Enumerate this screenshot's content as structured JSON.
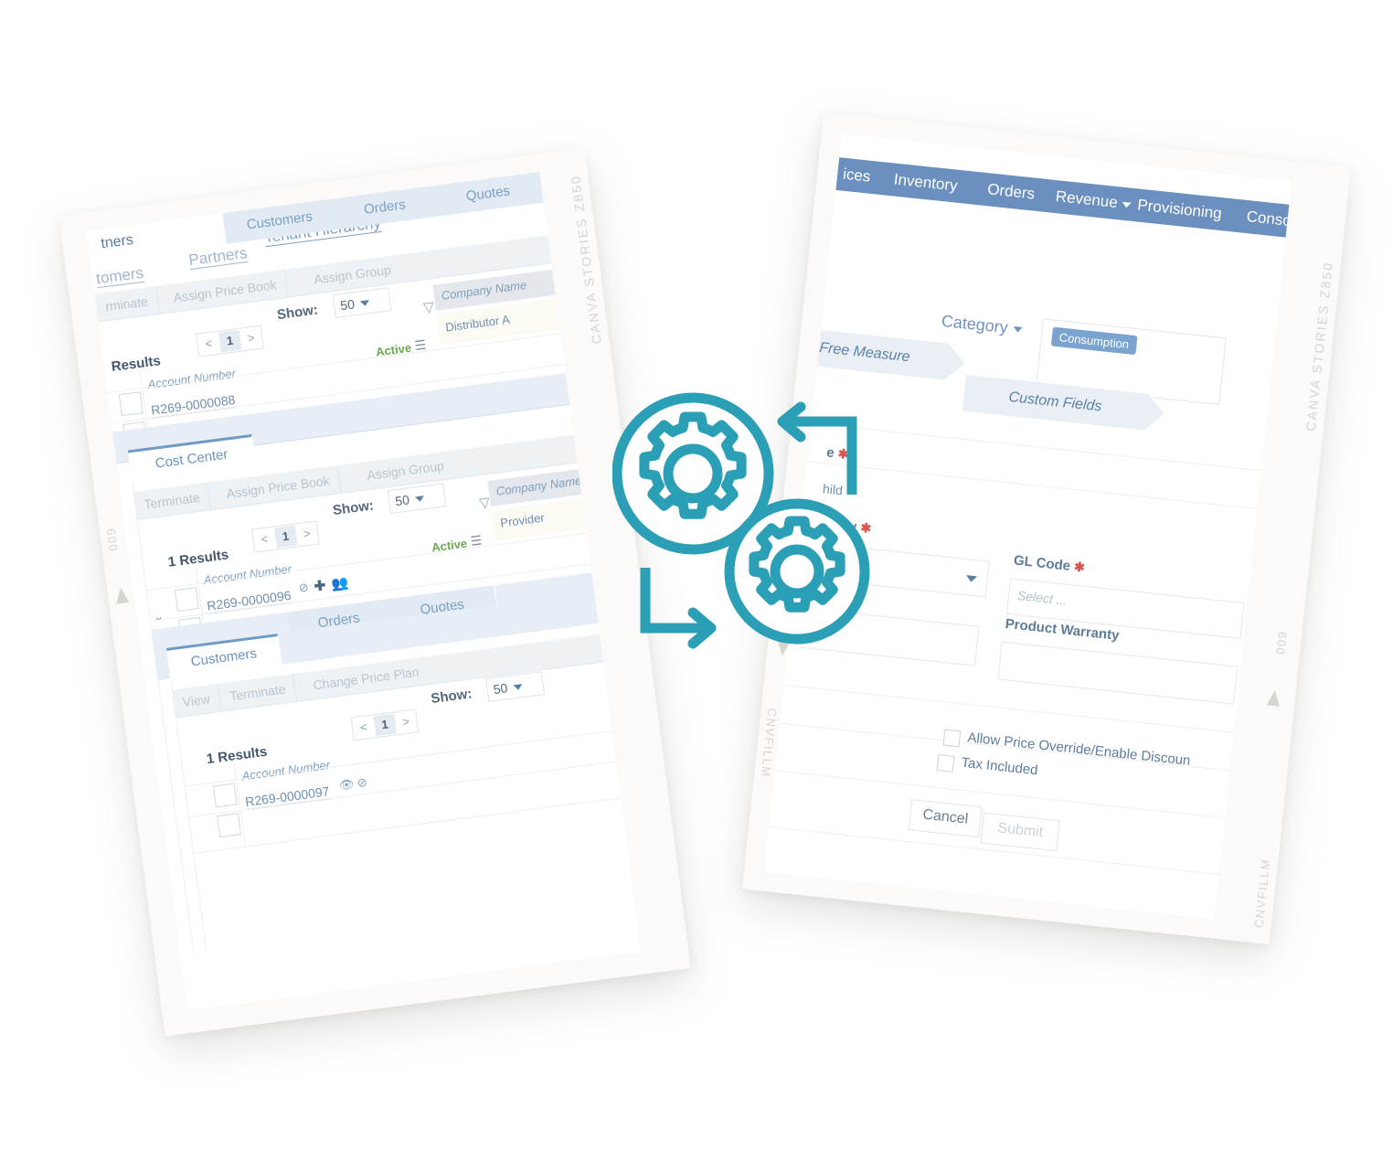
{
  "meta": {
    "background_color": "#ffffff",
    "accent_teal": "#2b9fb6",
    "nav_blue": "#6b8fbe",
    "link_blue": "#7aa0c4",
    "active_green": "#6aa84f",
    "required_red": "#d9534f"
  },
  "watermarks": {
    "brand_code": "CANVA STORIES Z850",
    "film_code": "CNVFILLM",
    "frame_number": "009"
  },
  "left_card": {
    "top_crumb": "tners",
    "top_tabs": [
      {
        "label": "tomers"
      },
      {
        "label": "Partners"
      },
      {
        "label": "Tenant Hierarchy"
      }
    ],
    "panels": [
      {
        "name": "partners-panel",
        "toolbar": [
          "rminate",
          "Assign Price Book",
          "Assign Group"
        ],
        "show_label": "Show:",
        "show_value": "50",
        "pager": {
          "prev": "<",
          "current": "1",
          "next": ">"
        },
        "results": "Results",
        "columns": [
          "Account Number",
          "Company Name"
        ],
        "status": "Active",
        "rows": [
          {
            "account_number": "R269-0000088",
            "company_name": "Distributor A"
          }
        ],
        "tabs": [
          {
            "label": "Cost Center",
            "active": true
          },
          {
            "label": "Customers",
            "active": false
          },
          {
            "label": "Orders",
            "active": false
          },
          {
            "label": "Quotes",
            "active": false
          }
        ]
      },
      {
        "name": "cost-center-panel",
        "toolbar": [
          "Terminate",
          "Assign Price Book",
          "Assign Group"
        ],
        "show_label": "Show:",
        "show_value": "50",
        "pager": {
          "prev": "<",
          "current": "1",
          "next": ">"
        },
        "results": "1 Results",
        "columns": [
          "Account Number",
          "Company Name"
        ],
        "status": "Active",
        "rows": [
          {
            "account_number": "R269-0000096",
            "company_name": "Provider"
          }
        ],
        "row_icons": [
          "block-icon",
          "plus-icon",
          "add-user-icon"
        ],
        "tabs": [
          {
            "label": "Customers",
            "active": true
          },
          {
            "label": "Orders",
            "active": false
          },
          {
            "label": "Quotes",
            "active": false
          }
        ]
      },
      {
        "name": "customers-panel",
        "toolbar": [
          "View",
          "Terminate",
          "Change Price Plan"
        ],
        "show_label": "Show:",
        "show_value": "50",
        "pager": {
          "prev": "<",
          "current": "1",
          "next": ">"
        },
        "results": "1 Results",
        "columns": [
          "Account Number"
        ],
        "rows": [
          {
            "account_number": "R269-0000097"
          }
        ],
        "row_icons": [
          "eye-icon",
          "block-icon"
        ]
      }
    ]
  },
  "right_card": {
    "navbar": [
      {
        "label": "ices",
        "has_caret": false
      },
      {
        "label": "Inventory",
        "has_caret": false
      },
      {
        "label": "Orders",
        "has_caret": false
      },
      {
        "label": "Revenue",
        "has_caret": true
      },
      {
        "label": "Provisioning",
        "has_caret": false
      },
      {
        "label": "Console",
        "has_caret": false
      }
    ],
    "wizard_steps": [
      {
        "label": "Free Measure"
      },
      {
        "label": "Custom Fields"
      }
    ],
    "category": {
      "label": "Category",
      "selected_token": "Consumption"
    },
    "fields": [
      {
        "label": "e",
        "required": true,
        "value": "",
        "type": "text"
      },
      {
        "label": "hild",
        "required": false,
        "value": "",
        "type": "text"
      },
      {
        "label": "uency",
        "required": true,
        "value": "",
        "type": "select"
      },
      {
        "label": "GL Code",
        "required": true,
        "placeholder": "Select ...",
        "type": "select"
      },
      {
        "label": "Product Warranty",
        "required": false,
        "value": "",
        "type": "text"
      }
    ],
    "checkboxes": [
      {
        "label": "Allow Price Override/Enable Discoun",
        "checked": false
      },
      {
        "label": "Tax Included",
        "checked": false
      }
    ],
    "buttons": [
      {
        "label": "Cancel",
        "state": "enabled"
      },
      {
        "label": "Submit",
        "state": "disabled"
      }
    ]
  },
  "graphic": {
    "name": "gears-sync-icon",
    "elements": [
      "gear-large-icon",
      "gear-small-icon",
      "arrow-left-icon",
      "arrow-right-icon"
    ],
    "color": "#2b9fb6"
  }
}
